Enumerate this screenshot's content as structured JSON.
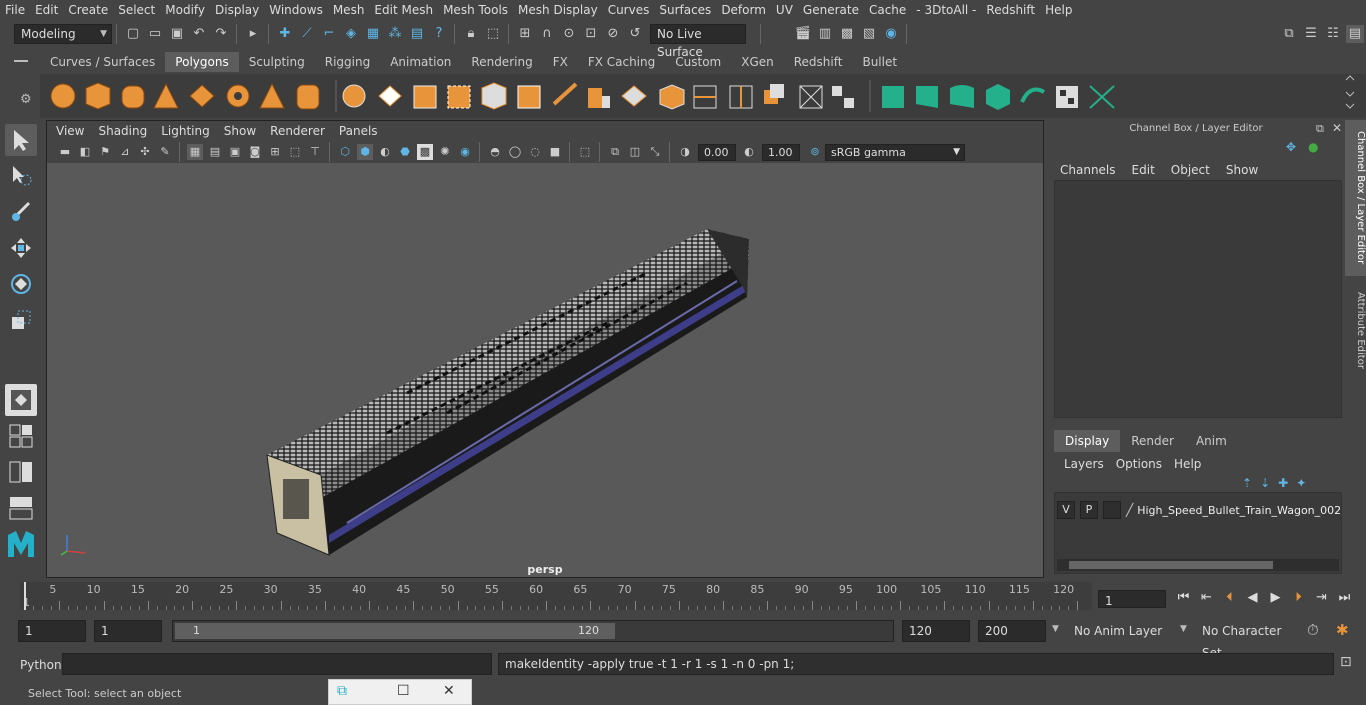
{
  "menubar": {
    "items": [
      "File",
      "Edit",
      "Create",
      "Select",
      "Modify",
      "Display",
      "Windows",
      "Mesh",
      "Edit Mesh",
      "Mesh Tools",
      "Mesh Display",
      "Curves",
      "Surfaces",
      "Deform",
      "UV",
      "Generate",
      "Cache",
      "- 3DtoAll -",
      "Redshift",
      "Help"
    ]
  },
  "statusline": {
    "mode": "Modeling",
    "live_surface": "No Live Surface"
  },
  "shelf": {
    "tabs": [
      "Curves / Surfaces",
      "Polygons",
      "Sculpting",
      "Rigging",
      "Animation",
      "Rendering",
      "FX",
      "FX Caching",
      "Custom",
      "XGen",
      "Redshift",
      "Bullet"
    ],
    "active_tab": "Polygons"
  },
  "viewport": {
    "menu": [
      "View",
      "Shading",
      "Lighting",
      "Show",
      "Renderer",
      "Panels"
    ],
    "exposure": "0.00",
    "gamma": "1.00",
    "color_space": "sRGB gamma",
    "camera": "persp"
  },
  "channelbox": {
    "title": "Channel Box / Layer Editor",
    "menu": [
      "Channels",
      "Edit",
      "Object",
      "Show"
    ],
    "layer_tabs": [
      "Display",
      "Render",
      "Anim"
    ],
    "active_layer_tab": "Display",
    "layer_menu": [
      "Layers",
      "Options",
      "Help"
    ],
    "layer": {
      "visible": "V",
      "playback": "P",
      "name": "High_Speed_Bullet_Train_Wagon_002"
    },
    "side_tabs": [
      "Channel Box / Layer Editor",
      "Attribute Editor"
    ]
  },
  "timeline": {
    "ticks": [
      "5",
      "10",
      "15",
      "20",
      "25",
      "30",
      "35",
      "40",
      "45",
      "50",
      "55",
      "60",
      "65",
      "70",
      "75",
      "80",
      "85",
      "90",
      "95",
      "100",
      "105",
      "110",
      "115",
      "120"
    ],
    "start_label": "1",
    "current_frame": "1"
  },
  "range": {
    "start": "1",
    "playback_start": "1",
    "slider_start": "1",
    "slider_end": "120",
    "playback_end": "120",
    "end": "200",
    "anim_layer": "No Anim Layer",
    "character_set": "No Character Set"
  },
  "commandline": {
    "language": "Python",
    "result": "makeIdentity -apply true -t 1 -r 1 -s 1 -n 0 -pn 1;"
  },
  "helpline": {
    "text": "Select Tool: select an object"
  },
  "colors": {
    "accent": "#5fb6e6",
    "shelf_orange": "#e8943a",
    "shelf_green": "#23b08a"
  }
}
